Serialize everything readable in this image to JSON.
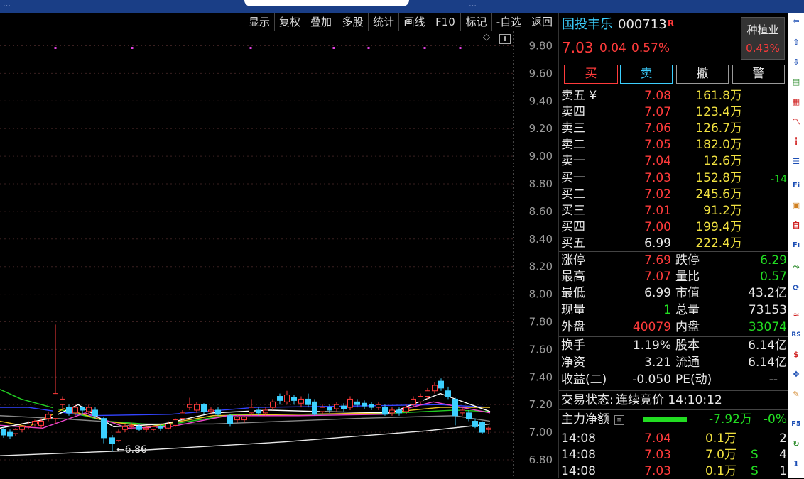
{
  "topbar": {
    "left_text": "…",
    "right_text": "…"
  },
  "toolbar": {
    "buttons": [
      "显示",
      "复权",
      "叠加",
      "多股",
      "统计",
      "画线",
      "F10",
      "标记",
      "-自选",
      "返回"
    ]
  },
  "chart": {
    "price_labels": [
      "9.80",
      "9.60",
      "9.40",
      "9.20",
      "9.00",
      "8.80",
      "8.60",
      "8.40",
      "8.20",
      "8.00",
      "7.80",
      "7.60",
      "7.40",
      "7.20",
      "7.00",
      "6.80"
    ],
    "low_marker": "←6.86"
  },
  "quote": {
    "name": "国投丰乐",
    "code": "000713",
    "flag": "R",
    "price": "7.03",
    "change": "0.04",
    "change_pct": "0.57%",
    "sector_name": "种植业",
    "sector_pct": "0.43%"
  },
  "actions": {
    "buy": "买",
    "sell": "卖",
    "cancel": "撤",
    "alert": "警"
  },
  "asks": [
    {
      "label": "卖五 ¥",
      "price": "7.08",
      "vol": "161.8万"
    },
    {
      "label": "卖四",
      "price": "7.07",
      "vol": "123.4万"
    },
    {
      "label": "卖三",
      "price": "7.06",
      "vol": "126.7万"
    },
    {
      "label": "卖二",
      "price": "7.05",
      "vol": "182.0万"
    },
    {
      "label": "卖一",
      "price": "7.04",
      "vol": "12.6万"
    }
  ],
  "bids": [
    {
      "label": "买一",
      "price": "7.03",
      "vol": "152.8万",
      "delta": "-14"
    },
    {
      "label": "买二",
      "price": "7.02",
      "vol": "245.6万",
      "delta": ""
    },
    {
      "label": "买三",
      "price": "7.01",
      "vol": "91.2万",
      "delta": ""
    },
    {
      "label": "买四",
      "price": "7.00",
      "vol": "199.4万",
      "delta": ""
    },
    {
      "label": "买五",
      "price": "6.99",
      "vol": "222.4万",
      "delta": ""
    }
  ],
  "stats": {
    "limit_up_label": "涨停",
    "limit_up": "7.69",
    "limit_down_label": "跌停",
    "limit_down": "6.29",
    "high_label": "最高",
    "high": "7.07",
    "vol_ratio_label": "量比",
    "vol_ratio": "0.57",
    "low_label": "最低",
    "low": "6.99",
    "mktcap_label": "市值",
    "mktcap": "43.2亿",
    "now_label": "现量",
    "now": "1",
    "total_label": "总量",
    "total": "73153",
    "outer_label": "外盘",
    "outer": "40079",
    "inner_label": "内盘",
    "inner": "33074",
    "turnover_label": "换手",
    "turnover": "1.19%",
    "share_label": "股本",
    "share": "6.14亿",
    "nav_label": "净资",
    "nav": "3.21",
    "float_label": "流通",
    "float": "6.14亿",
    "eps_label": "收益(二)",
    "eps": "-0.050",
    "pe_label": "PE(动)",
    "pe": "--"
  },
  "status": {
    "label": "交易状态:",
    "value": "连续竞价 14:10:12"
  },
  "mainflow": {
    "label": "主力净额",
    "value": "-7.92万",
    "pct": "-0%"
  },
  "trades": [
    {
      "time": "14:08",
      "price": "7.04",
      "vol": "0.1万",
      "side": "",
      "count": "2"
    },
    {
      "time": "14:08",
      "price": "7.03",
      "vol": "7.0万",
      "side": "S",
      "count": "4"
    },
    {
      "time": "14:08",
      "price": "7.03",
      "vol": "0.1万",
      "side": "S",
      "count": "1"
    }
  ],
  "iconbar": {
    "labels": [
      "Fi",
      "Fı",
      "RS",
      "F5",
      "1"
    ]
  },
  "colors": {
    "up": "#ff3b3b",
    "down": "#22dd22",
    "vol": "#f0e040",
    "accent": "#3cd0ff"
  }
}
